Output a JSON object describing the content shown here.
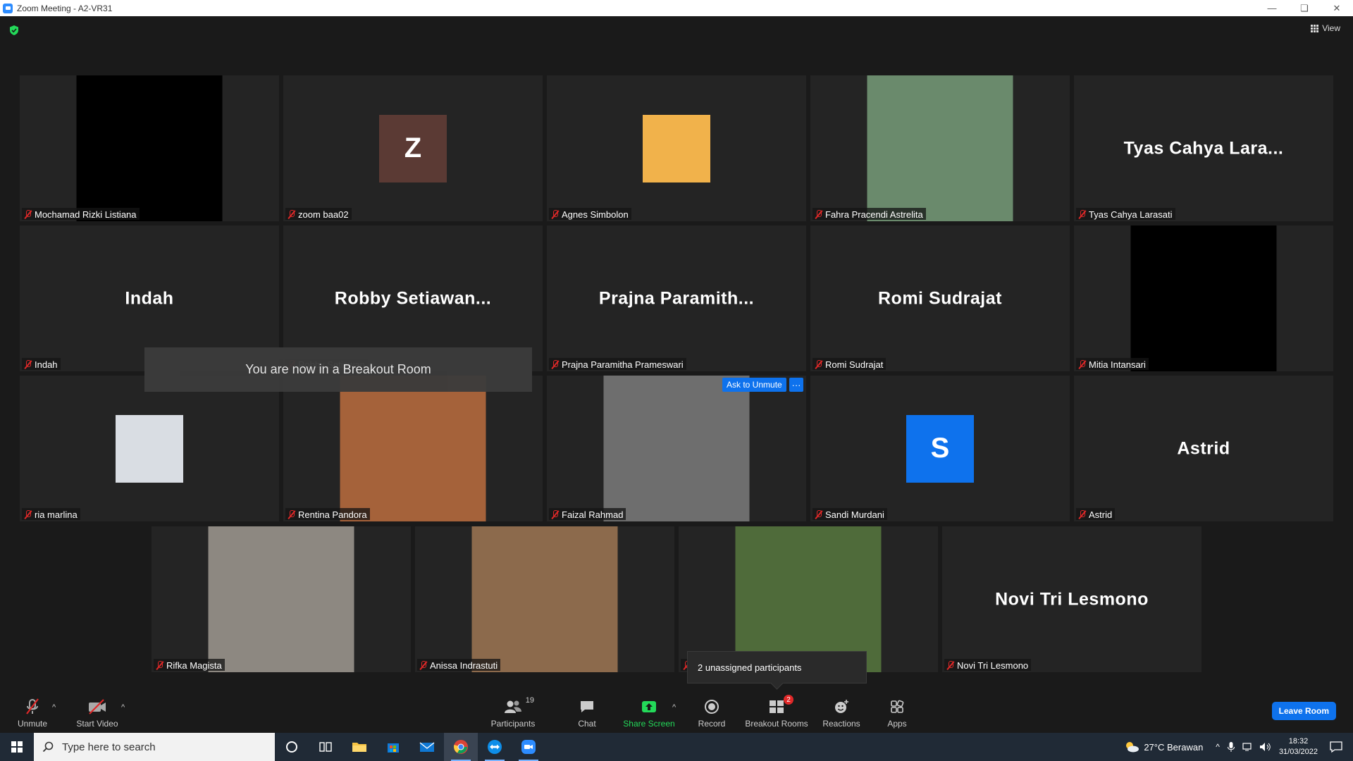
{
  "window": {
    "title": "Zoom Meeting - A2-VR31"
  },
  "view_label": "View",
  "toast": "You are now in a Breakout Room",
  "ask_unmute": "Ask to Unmute",
  "more_dots": "···",
  "unassigned": "2 unassigned participants",
  "tiles": [
    {
      "name": "Mochamad Rizki Listiana",
      "kind": "video",
      "bg": "#000000"
    },
    {
      "name": "zoom baa02",
      "kind": "avatar",
      "initial": "Z",
      "color": "#5b3a34"
    },
    {
      "name": "Agnes Simbolon",
      "kind": "smallpic",
      "bg": "#f1b24b"
    },
    {
      "name": "Fahra Pracendi Astrelita",
      "kind": "video",
      "bg": "#6a8a6c"
    },
    {
      "name": "Tyas Cahya Larasati",
      "kind": "text",
      "big": "Tyas Cahya Lara..."
    },
    {
      "name": "Indah",
      "kind": "text",
      "big": "Indah"
    },
    {
      "name": "Robby Setiawan",
      "kind": "text",
      "big": "Robby Setiawan..."
    },
    {
      "name": "Prajna Paramitha Prameswari",
      "kind": "text",
      "big": "Prajna Paramith..."
    },
    {
      "name": "Romi Sudrajat",
      "kind": "text",
      "big": "Romi Sudrajat"
    },
    {
      "name": "Mitia Intansari",
      "kind": "video",
      "bg": "#000000"
    },
    {
      "name": "ria marlina",
      "kind": "smallpic",
      "bg": "#d9dde3"
    },
    {
      "name": "Rentina Pandora",
      "kind": "video",
      "bg": "#a5623a"
    },
    {
      "name": "Faizal Rahmad",
      "kind": "video",
      "bg": "#6e6e6e"
    },
    {
      "name": "Sandi Murdani",
      "kind": "avatar",
      "initial": "S",
      "color": "#0e72ed"
    },
    {
      "name": "Astrid",
      "kind": "text",
      "big": "Astrid"
    },
    {
      "name": "Rifka Magista",
      "kind": "video",
      "bg": "#8d8881"
    },
    {
      "name": "Anissa Indrastuti",
      "kind": "video",
      "bg": "#8c6a4c"
    },
    {
      "name": "",
      "kind": "video",
      "bg": "#4f6b3a"
    },
    {
      "name": "Novi Tri Lesmono",
      "kind": "text",
      "big": "Novi Tri Lesmono"
    }
  ],
  "toolbar": {
    "unmute": "Unmute",
    "start_video": "Start Video",
    "participants": "Participants",
    "participants_count": "19",
    "chat": "Chat",
    "share_screen": "Share Screen",
    "record": "Record",
    "breakout_rooms": "Breakout Rooms",
    "breakout_badge": "2",
    "reactions": "Reactions",
    "apps": "Apps",
    "leave": "Leave Room"
  },
  "taskbar": {
    "search_placeholder": "Type here to search",
    "weather": "27°C  Berawan",
    "time": "18:32",
    "date": "31/03/2022"
  },
  "colors": {
    "accent": "#0e72ed",
    "share_green": "#23d959",
    "mute_red": "#e02828"
  }
}
